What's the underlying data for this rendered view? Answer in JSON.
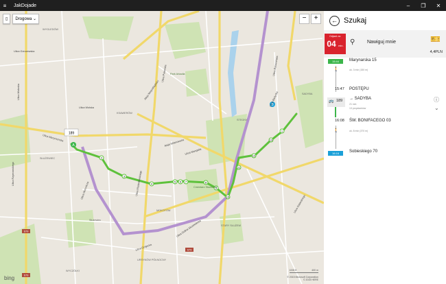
{
  "window": {
    "title": "JakDojade",
    "menu_icon": "hamburger-icon",
    "controls": [
      "–",
      "❐",
      "✕"
    ]
  },
  "map": {
    "layer_label": "Drogowa",
    "zoom_minus": "−",
    "zoom_plus": "+",
    "bing_label": "bing",
    "copyright_lines": [
      "© 2015 Microsoft Corporation",
      "© 2015 HERE"
    ],
    "scale_labels": [
      "1000 ft",
      "400 m"
    ],
    "street_labels": [
      "Ulica Marymoncka",
      "Ulica Wolska",
      "Ulica Górczewska",
      "Ulica Grójecka",
      "Ulica Puławska",
      "Aleja Wilanowska",
      "Ulica Dolina Służewiecka",
      "Ulica Woronicza",
      "Ulica Wołoska",
      "Ulica Rzymowskiego",
      "Ulica Modzelewskiego",
      "Ulica Sobieskiego",
      "Ulica Bartycka",
      "Aleja Niepodległości",
      "Ulica Mangalia",
      "Ulica Bukowińska",
      "WYGLEDÓW",
      "KSAWERÓW",
      "SŁUŻEWIEC",
      "MOKOTÓW",
      "STEGNY",
      "SADYBA",
      "STARY SŁUŻEW",
      "URSYNÓW PÓŁNOCNY",
      "WYCZÓŁKI",
      "Cmentarz Służewski",
      "Park Arkadia",
      "Służewiec"
    ],
    "road_badges": [
      "S79",
      "S79",
      "S79"
    ],
    "stop_numbers": [
      "1",
      "2",
      "3",
      "4",
      "5",
      "6",
      "7",
      "8",
      "9",
      "10",
      "11",
      "12",
      "13"
    ],
    "start_marker": "A",
    "end_marker": "B",
    "bus_label": "189",
    "colors": {
      "route": "#5ec13c",
      "major_road": "#f1d86a",
      "express": "#b492cf",
      "park": "#c7dfab",
      "water": "#aad2ec"
    }
  },
  "panel": {
    "title": "Szukaj",
    "depart": {
      "label_line1": "Odjazd za:",
      "minutes": "04",
      "unit": "min."
    },
    "navigate_label": "Nawiguj mnie",
    "price": "4,4PLN",
    "items": [
      {
        "time_badge": "15:44",
        "text": "Marynarska 15"
      },
      {
        "sub": "ok. 3 min (150 m)"
      },
      {
        "time": "15:47",
        "text": "POSTĘPU"
      },
      {
        "line": "189",
        "text": "→ SADYBA",
        "sub1": "21 min",
        "sub2": "13 przystanków"
      },
      {
        "time": "16:08",
        "text": "ŚW. BONIFACEGO 03"
      },
      {
        "sub": "ok. 8 min (370 m)"
      },
      {
        "time_badge": "16:16",
        "text": "Sobieskiego 70"
      }
    ],
    "colors": {
      "depart_bg": "#d9232d",
      "start_badge": "#3bb54a",
      "end_badge": "#1ba0d8"
    }
  }
}
